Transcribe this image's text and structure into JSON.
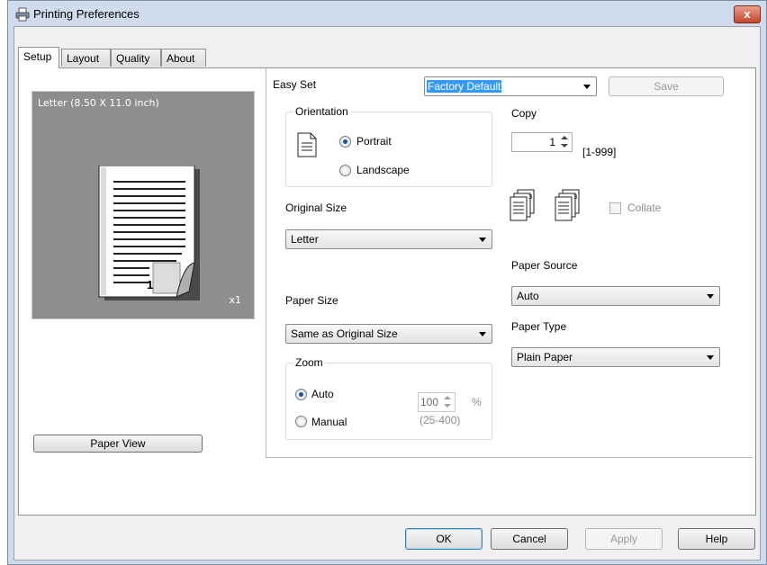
{
  "window": {
    "title": "Printing Preferences",
    "close_label": "x"
  },
  "tabs": [
    {
      "label": "Setup",
      "active": true
    },
    {
      "label": "Layout",
      "active": false
    },
    {
      "label": "Quality",
      "active": false
    },
    {
      "label": "About",
      "active": false
    }
  ],
  "preview": {
    "paper_label": "Letter  (8.50 X 11.0 inch)",
    "page_number": "1",
    "copies_marker": "x1",
    "paper_view_label": "Paper View"
  },
  "easy_set": {
    "label": "Easy Set",
    "value": "Factory Default",
    "save_label": "Save"
  },
  "orientation": {
    "title": "Orientation",
    "portrait_label": "Portrait",
    "landscape_label": "Landscape",
    "selected": "Portrait"
  },
  "original_size": {
    "label": "Original Size",
    "value": "Letter"
  },
  "paper_size": {
    "label": "Paper Size",
    "value": "Same as Original Size"
  },
  "zoom": {
    "title": "Zoom",
    "auto_label": "Auto",
    "manual_label": "Manual",
    "selected": "Auto",
    "value": "100",
    "unit": "%",
    "range": "(25-400)"
  },
  "copy": {
    "label": "Copy",
    "value": "1",
    "range": "[1-999]",
    "collate_label": "Collate",
    "collate_checked": false
  },
  "paper_source": {
    "label": "Paper Source",
    "value": "Auto"
  },
  "paper_type": {
    "label": "Paper Type",
    "value": "Plain Paper"
  },
  "buttons": {
    "ok": "OK",
    "cancel": "Cancel",
    "apply": "Apply",
    "help": "Help"
  },
  "colors": {
    "preview_bg": "#8e8e8e",
    "selection": "#3399ff",
    "close_red": "#c6452d",
    "window_frame": "#cfdcec"
  }
}
